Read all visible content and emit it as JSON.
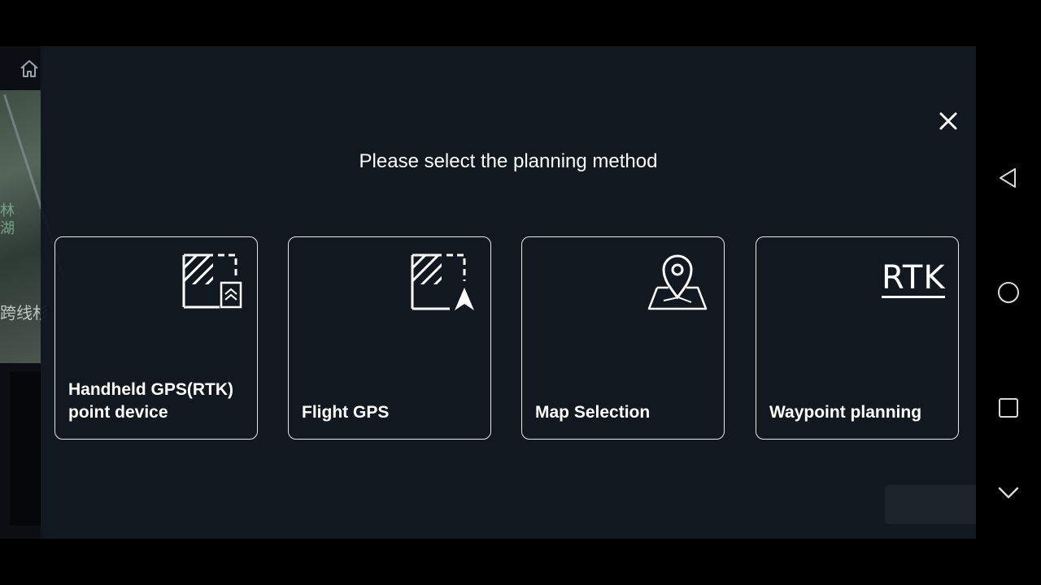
{
  "dialog": {
    "title": "Please select the planning method",
    "options": [
      {
        "label": "Handheld GPS(RTK) point device",
        "icon": "handheld-rtk-icon"
      },
      {
        "label": "Flight GPS",
        "icon": "flight-gps-icon"
      },
      {
        "label": "Map Selection",
        "icon": "map-pin-icon"
      },
      {
        "label": "Waypoint planning",
        "icon": "rtk-icon"
      }
    ],
    "rtk_icon_text": "RTK"
  },
  "background": {
    "map_text_1": "跨线杉",
    "map_text_2": "林\n湖"
  },
  "icons": {
    "home": "home-icon",
    "close": "close-icon",
    "nav_back": "back-triangle-icon",
    "nav_home": "home-circle-icon",
    "nav_recents": "recents-square-icon",
    "nav_collapse": "chevron-down-icon"
  }
}
